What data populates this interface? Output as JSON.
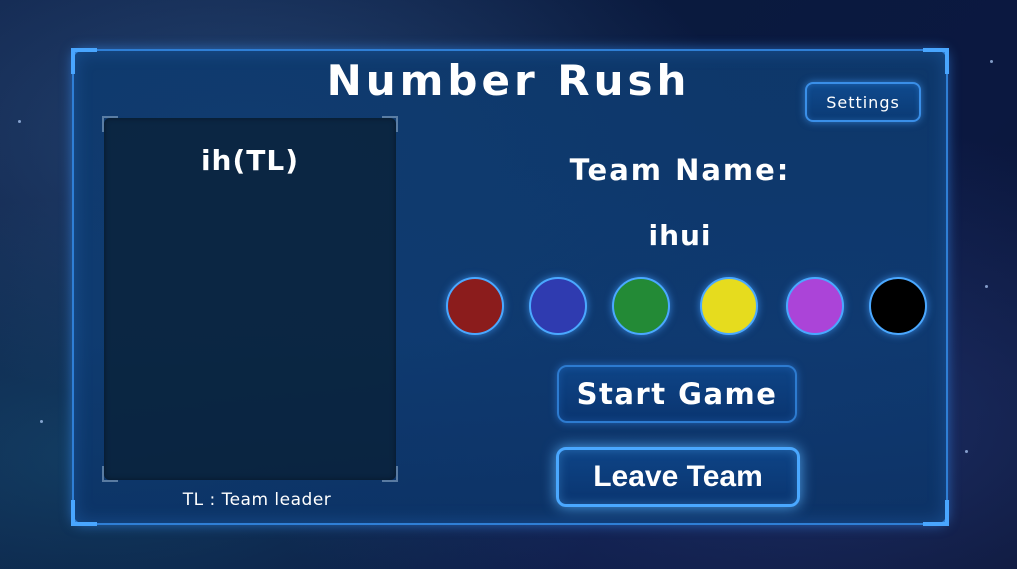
{
  "title": "Number Rush",
  "settings": {
    "label": "Settings"
  },
  "players": {
    "list": [
      "ih(TL)"
    ],
    "legend": "TL : Team leader"
  },
  "team": {
    "label": "Team Name:",
    "value": "ihui"
  },
  "colors": [
    {
      "name": "red",
      "hex": "#8b1c1c"
    },
    {
      "name": "blue",
      "hex": "#2f3bb0"
    },
    {
      "name": "green",
      "hex": "#238a36"
    },
    {
      "name": "yellow",
      "hex": "#e6dc1e"
    },
    {
      "name": "purple",
      "hex": "#ab44d8"
    },
    {
      "name": "black",
      "hex": "#000000"
    }
  ],
  "actions": {
    "start_label": "Start Game",
    "leave_label": "Leave Team"
  }
}
